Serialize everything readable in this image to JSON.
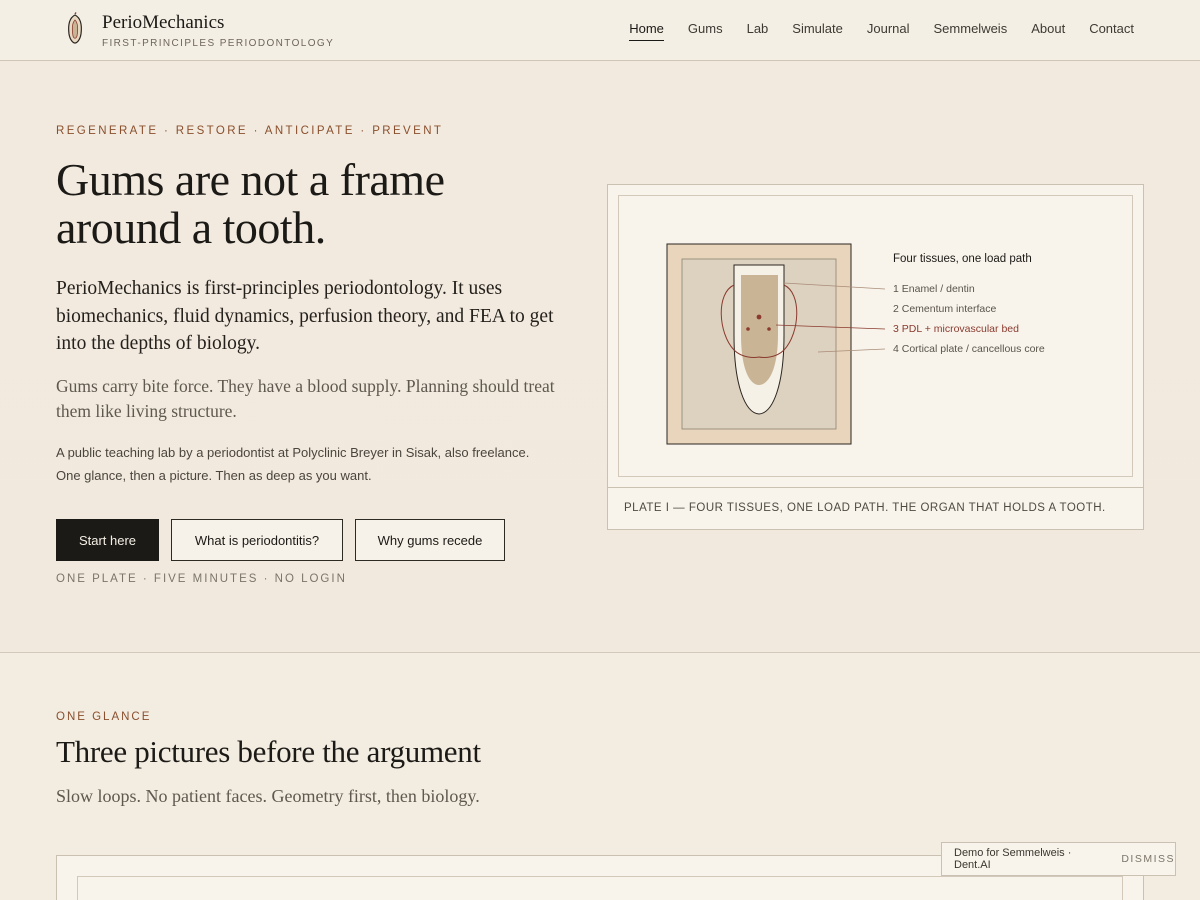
{
  "brand": {
    "name": "PerioMechanics",
    "tagline": "FIRST-PRINCIPLES PERIODONTOLOGY"
  },
  "nav": [
    "Home",
    "Gums",
    "Lab",
    "Simulate",
    "Journal",
    "Semmelweis",
    "About",
    "Contact"
  ],
  "hero": {
    "kicker": "REGENERATE · RESTORE · ANTICIPATE · PREVENT",
    "title": "Gums are not a frame around a tooth.",
    "lead": "PerioMechanics is first-principles periodontology. It uses biomechanics, fluid dynamics, perfusion theory, and FEA to get into the depths of biology.",
    "sublead": "Gums carry bite force. They have a blood supply. Planning should treat them like living structure.",
    "small_line1": "A public teaching lab by a periodontist at Polyclinic Breyer in Sisak, also freelance.",
    "small_line2": "One glance, then a picture. Then as deep as you want.",
    "buttons": {
      "start": "Start here",
      "what": "What is periodontitis?",
      "why": "Why gums recede"
    },
    "meta": "ONE PLATE · FIVE MINUTES · NO LOGIN"
  },
  "plate": {
    "legend_title": "Four tissues, one load path",
    "legend": [
      "1 Enamel / dentin",
      "2 Cementum interface",
      "3 PDL + microvascular bed",
      "4 Cortical plate / cancellous core"
    ],
    "caption": "PLATE I — FOUR TISSUES, ONE LOAD PATH. THE ORGAN THAT HOLDS A TOOTH.",
    "colors": {
      "accent": "#8a3a2e",
      "bone": "#e8d5bc",
      "socket": "#ddd1bf",
      "dentin": "#c9b596"
    }
  },
  "glance": {
    "kicker": "ONE GLANCE",
    "title": "Three pictures before the argument",
    "subtitle": "Slow loops. No patient faces. Geometry first, then biology."
  },
  "toast": {
    "text": "Demo for Semmelweis · Dent.AI",
    "dismiss": "DISMISS"
  }
}
